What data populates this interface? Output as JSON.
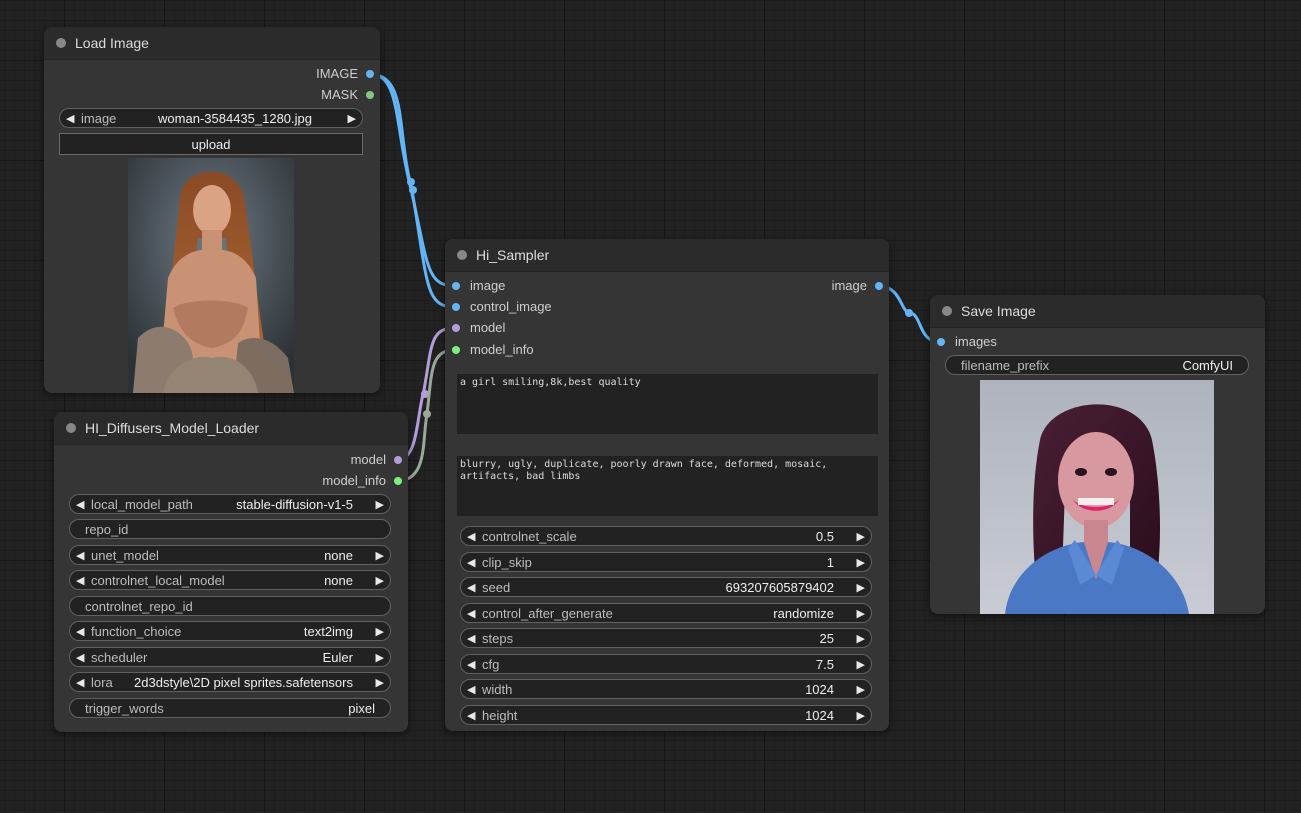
{
  "colors": {
    "image": "#64b5f6",
    "mask": "#81c784",
    "model": "#b39ddb",
    "model_info": "#7cf07c"
  },
  "load_image": {
    "title": "Load Image",
    "outputs": [
      "IMAGE",
      "MASK"
    ],
    "image_label": "image",
    "image_value": "woman-3584435_1280.jpg",
    "upload_label": "upload"
  },
  "model_loader": {
    "title": "HI_Diffusers_Model_Loader",
    "outputs": [
      "model",
      "model_info"
    ],
    "widgets": [
      {
        "label": "local_model_path",
        "value": "stable-diffusion-v1-5"
      },
      {
        "label": "repo_id",
        "value": ""
      },
      {
        "label": "unet_model",
        "value": "none"
      },
      {
        "label": "controlnet_local_model",
        "value": "none"
      },
      {
        "label": "controlnet_repo_id",
        "value": ""
      },
      {
        "label": "function_choice",
        "value": "text2img"
      },
      {
        "label": "scheduler",
        "value": "Euler"
      },
      {
        "label": "lora",
        "value": "2d3dstyle\\2D pixel sprites.safetensors"
      },
      {
        "label": "trigger_words",
        "value": "pixel"
      }
    ]
  },
  "sampler": {
    "title": "Hi_Sampler",
    "inputs": [
      "image",
      "control_image",
      "model",
      "model_info"
    ],
    "output": "image",
    "positive_prompt": "a girl smiling,8k,best quality",
    "negative_prompt": "blurry, ugly, duplicate, poorly drawn face, deformed, mosaic, artifacts, bad limbs",
    "widgets": [
      {
        "label": "controlnet_scale",
        "value": "0.5"
      },
      {
        "label": "clip_skip",
        "value": "1"
      },
      {
        "label": "seed",
        "value": "693207605879402"
      },
      {
        "label": "control_after_generate",
        "value": "randomize"
      },
      {
        "label": "steps",
        "value": "25"
      },
      {
        "label": "cfg",
        "value": "7.5"
      },
      {
        "label": "width",
        "value": "1024"
      },
      {
        "label": "height",
        "value": "1024"
      }
    ]
  },
  "save_image": {
    "title": "Save Image",
    "input": "images",
    "prefix_label": "filename_prefix",
    "prefix_value": "ComfyUI"
  }
}
